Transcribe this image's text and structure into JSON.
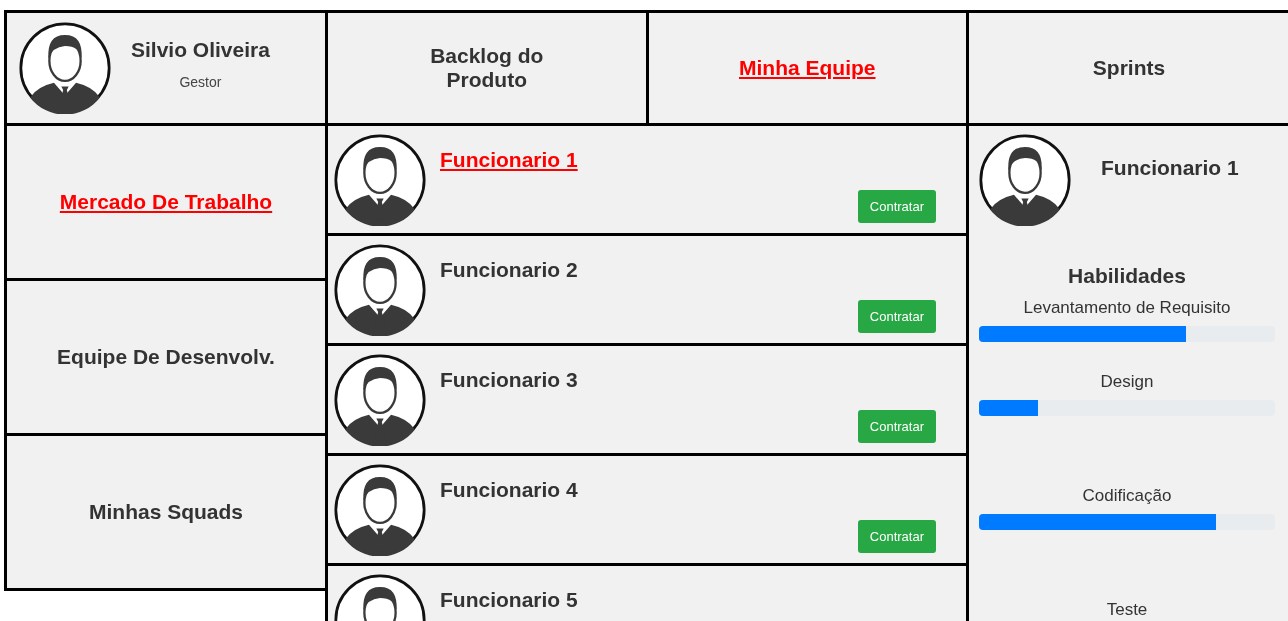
{
  "profile": {
    "name": "Silvio Oliveira",
    "role": "Gestor"
  },
  "sidebar": {
    "items": [
      {
        "label": "Mercado De Trabalho",
        "selected": true
      },
      {
        "label": "Equipe De Desenvolv.",
        "selected": false
      },
      {
        "label": "Minhas Squads",
        "selected": false
      }
    ]
  },
  "top_nav": {
    "items": [
      {
        "label": "Backlog do Produto",
        "selected": false
      },
      {
        "label": "Minha Equipe",
        "selected": true
      }
    ]
  },
  "employees": [
    {
      "name": "Funcionario 1",
      "selected": true,
      "button": "Contratar"
    },
    {
      "name": "Funcionario 2",
      "selected": false,
      "button": "Contratar"
    },
    {
      "name": "Funcionario 3",
      "selected": false,
      "button": "Contratar"
    },
    {
      "name": "Funcionario 4",
      "selected": false,
      "button": "Contratar"
    },
    {
      "name": "Funcionario 5",
      "selected": false
    }
  ],
  "right_panel": {
    "header": "Sprints",
    "employee_name": "Funcionario 1",
    "skills_title": "Habilidades",
    "skills": [
      {
        "label": "Levantamento de Requisito",
        "level": 0.7
      },
      {
        "label": "Design",
        "level": 0.2
      },
      {
        "label": "Codificação",
        "level": 0.8
      },
      {
        "label": "Teste"
      }
    ]
  }
}
